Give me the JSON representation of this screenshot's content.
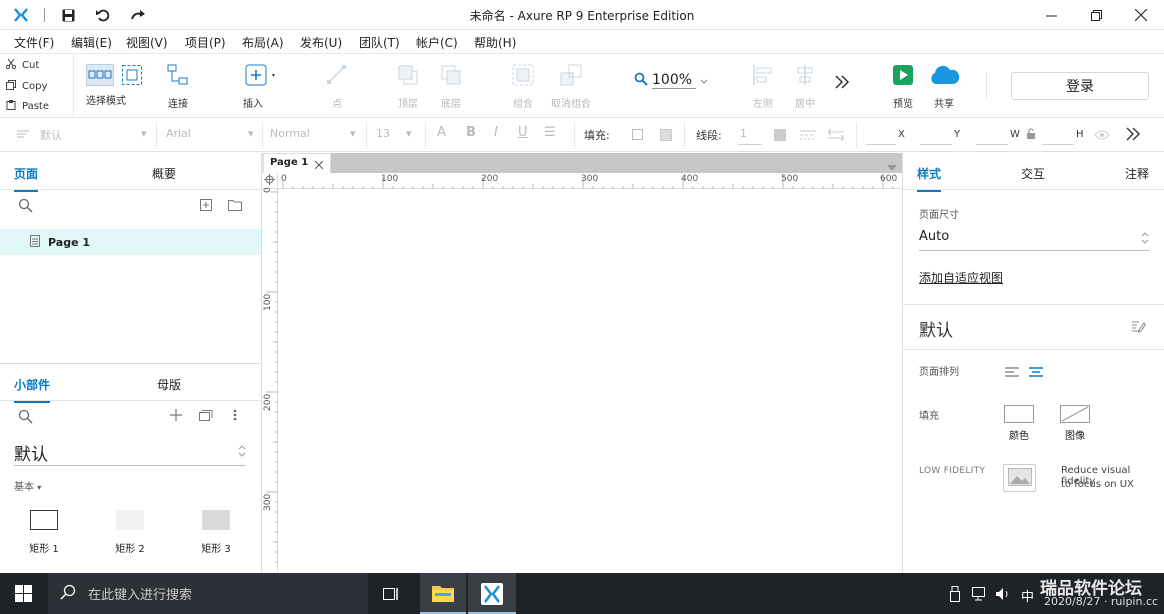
{
  "window": {
    "title": "未命名 - Axure RP 9 Enterprise Edition"
  },
  "menu": [
    "文件(F)",
    "编辑(E)",
    "视图(V)",
    "项目(P)",
    "布局(A)",
    "发布(U)",
    "团队(T)",
    "帐户(C)",
    "帮助(H)"
  ],
  "clipboard": {
    "cut": "Cut",
    "copy": "Copy",
    "paste": "Paste"
  },
  "toolbar": {
    "select_mode": "选择模式",
    "connect": "连接",
    "insert": "插入",
    "point": "点",
    "top_layer": "顶层",
    "bottom_layer": "底层",
    "group": "组合",
    "ungroup": "取消组合",
    "zoom": "100%",
    "left": "左侧",
    "center": "居中",
    "preview": "预览",
    "share": "共享",
    "login": "登录",
    "preview_color": "#1aa35f",
    "share_color": "#1a95e0"
  },
  "format": {
    "style": "默认",
    "font": "Arial",
    "weight": "Normal",
    "size": "13",
    "fill_label": "填充:",
    "stroke_label": "线段:",
    "stroke_value": "1",
    "x_label": "X",
    "y_label": "Y",
    "w_label": "W",
    "h_label": "H"
  },
  "pages_panel": {
    "tab_pages": "页面",
    "tab_outline": "概要",
    "pages": [
      "Page 1"
    ]
  },
  "widgets_panel": {
    "tab_widgets": "小部件",
    "tab_masters": "母版",
    "library": "默认",
    "group": "基本",
    "items": [
      "矩形 1",
      "矩形 2",
      "矩形 3"
    ]
  },
  "canvas": {
    "tab": "Page 1",
    "ruler_h": [
      "0",
      "100",
      "200",
      "300",
      "400",
      "500",
      "600"
    ],
    "ruler_v": [
      "0",
      "100",
      "200",
      "300"
    ]
  },
  "style_panel": {
    "tab_style": "样式",
    "tab_interact": "交互",
    "tab_notes": "注释",
    "page_size_label": "页面尺寸",
    "page_size_value": "Auto",
    "adaptive_link": "添加自适应视图",
    "style_name": "默认",
    "alignment_label": "页面排列",
    "fill_label": "填充",
    "fill_color": "颜色",
    "fill_image": "图像",
    "low_fidelity_label": "LOW FIDELITY",
    "low_fidelity_desc_1": "Reduce visual fidelity",
    "low_fidelity_desc_2": "to focus on UX"
  },
  "taskbar": {
    "search_placeholder": "在此键入进行搜索",
    "ime": "中",
    "watermark_1": "瑞品软件论坛",
    "watermark_2": "2020/8/27 · ruipin.cc"
  },
  "accent": "#0a7bc2"
}
